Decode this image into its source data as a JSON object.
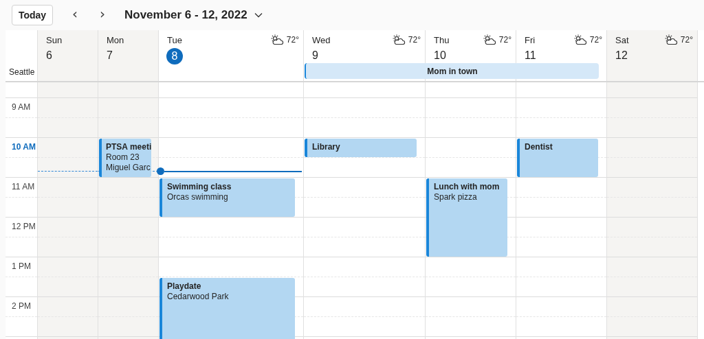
{
  "toolbar": {
    "today_button": "Today",
    "previous": "‹",
    "next": "›",
    "range_title": "November 6 - 12, 2022"
  },
  "time_zone": "Seattle",
  "all_day_event": {
    "title": "Mom in town"
  },
  "days": [
    {
      "name": "Sun",
      "date": "6",
      "today": false,
      "working_day": false,
      "kind": "plain"
    },
    {
      "name": "Mon",
      "date": "7",
      "today": false,
      "working_day": false,
      "kind": "plain"
    },
    {
      "name": "Tue",
      "date": "8",
      "today": true,
      "working_day": true,
      "weather": "72°",
      "kind": "plain"
    },
    {
      "name": "Wed",
      "date": "9",
      "today": false,
      "working_day": true,
      "weather": "72°",
      "kind": "start"
    },
    {
      "name": "Thu",
      "date": "10",
      "today": false,
      "working_day": true,
      "weather": "72°",
      "kind": "middle"
    },
    {
      "name": "Fri",
      "date": "11",
      "today": false,
      "working_day": true,
      "weather": "72°",
      "kind": "end"
    },
    {
      "name": "Sat",
      "date": "12",
      "today": false,
      "working_day": false,
      "weather": "72°",
      "kind": "plain"
    }
  ],
  "hours": [
    {
      "label": "9 AM",
      "current": false,
      "cells": [
        {
          "kind": "empty"
        },
        {
          "kind": "empty"
        },
        {
          "kind": "empty"
        },
        {
          "kind": "empty"
        },
        {
          "kind": "empty"
        },
        {
          "kind": "empty"
        },
        {
          "kind": "empty"
        }
      ]
    },
    {
      "label": "10 AM",
      "current": true,
      "cells": [
        {
          "kind": "empty"
        },
        {
          "kind": "hour",
          "title": "PTSA meeti",
          "lines": [
            "Room 23",
            "Miguel Garc"
          ]
        },
        {
          "kind": "empty"
        },
        {
          "kind": "half",
          "title": "Library"
        },
        {
          "kind": "empty"
        },
        {
          "kind": "hour",
          "title": "Dentist"
        },
        {
          "kind": "empty"
        }
      ]
    },
    {
      "label": "11 AM",
      "current": false,
      "cells": [
        {
          "kind": "empty"
        },
        {
          "kind": "empty"
        },
        {
          "kind": "hour",
          "title": "Swimming class",
          "lines": [
            "Orcas swimming"
          ]
        },
        {
          "kind": "empty"
        },
        {
          "kind": "double",
          "title": "Lunch with mom",
          "lines": [
            "Spark pizza"
          ]
        },
        {
          "kind": "empty"
        },
        {
          "kind": "empty"
        }
      ]
    },
    {
      "label": "12 PM",
      "current": false,
      "cells": [
        {
          "kind": "empty"
        },
        {
          "kind": "empty"
        },
        {
          "kind": "empty"
        },
        {
          "kind": "empty"
        },
        {
          "kind": "empty"
        },
        {
          "kind": "empty"
        },
        {
          "kind": "empty"
        }
      ]
    },
    {
      "label": "1 PM",
      "current": false,
      "cells": [
        {
          "kind": "empty"
        },
        {
          "kind": "empty"
        },
        {
          "kind": "late",
          "title": "Playdate",
          "lines": [
            "Cedarwood Park"
          ]
        },
        {
          "kind": "empty"
        },
        {
          "kind": "empty"
        },
        {
          "kind": "empty"
        },
        {
          "kind": "empty"
        }
      ]
    },
    {
      "label": "2 PM",
      "current": false,
      "cells": [
        {
          "kind": "empty"
        },
        {
          "kind": "empty"
        },
        {
          "kind": "empty"
        },
        {
          "kind": "empty"
        },
        {
          "kind": "empty"
        },
        {
          "kind": "empty"
        },
        {
          "kind": "empty"
        }
      ]
    }
  ]
}
